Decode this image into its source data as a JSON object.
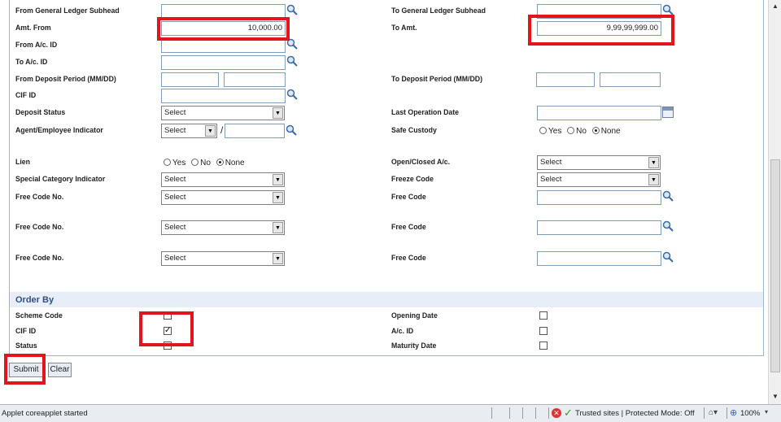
{
  "form": {
    "labels": {
      "from_gl_subhead": "From General Ledger Subhead",
      "to_gl_subhead": "To General Ledger Subhead",
      "amt_from": "Amt. From",
      "to_amt": "To Amt.",
      "from_ac_id": "From A/c. ID",
      "to_ac_id": "To A/c. ID",
      "from_deposit_period": "From Deposit Period (MM/DD)",
      "to_deposit_period": "To Deposit Period (MM/DD)",
      "cif_id": "CIF ID",
      "deposit_status": "Deposit Status",
      "last_operation_date": "Last Operation Date",
      "agent_employee_indicator": "Agent/Employee Indicator",
      "safe_custody": "Safe Custody",
      "lien": "Lien",
      "open_closed_ac": "Open/Closed A/c.",
      "special_category_indicator": "Special Category Indicator",
      "freeze_code": "Freeze Code",
      "free_code_no_1": "Free Code No.",
      "free_code_1": "Free Code",
      "free_code_no_2": "Free Code No.",
      "free_code_2": "Free Code",
      "free_code_no_3": "Free Code No.",
      "free_code_3": "Free Code"
    },
    "values": {
      "amt_from": "10,000.00",
      "to_amt": "9,99,99,999.00",
      "agent_separator": "/"
    },
    "select_default": "Select",
    "radio_options": {
      "yes": "Yes",
      "no": "No",
      "none": "None"
    }
  },
  "order_by": {
    "title": "Order By",
    "scheme_code": "Scheme Code",
    "cif_id": "CIF ID",
    "status": "Status",
    "opening_date": "Opening Date",
    "ac_id": "A/c. ID",
    "maturity_date": "Maturity Date",
    "cif_checked_mark": "✓"
  },
  "buttons": {
    "submit": "Submit",
    "clear": "Clear"
  },
  "statusbar": {
    "message": "Applet coreapplet started",
    "zone": "Trusted sites | Protected Mode: Off",
    "zoom": "100%"
  },
  "colors": {
    "highlight": "#e3141b",
    "accent": "#2f4f8f"
  },
  "icons": [
    "search-icon",
    "calendar-icon",
    "dropdown-arrow-icon",
    "scroll-up-icon",
    "scroll-down-icon"
  ]
}
